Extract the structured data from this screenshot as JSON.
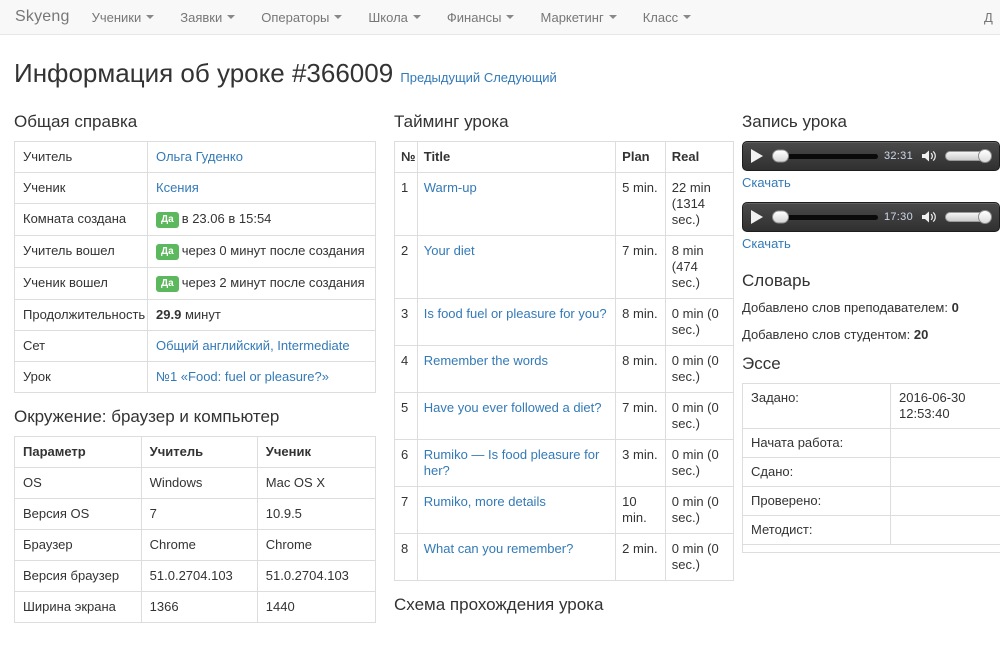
{
  "navbar": {
    "brand": "Skyeng",
    "items": [
      {
        "label": "Ученики",
        "caret": true
      },
      {
        "label": "Заявки",
        "caret": true
      },
      {
        "label": "Операторы",
        "caret": true
      },
      {
        "label": "Школа",
        "caret": true
      },
      {
        "label": "Финансы",
        "caret": true
      },
      {
        "label": "Маркетинг",
        "caret": true
      },
      {
        "label": "Класс",
        "caret": true
      }
    ],
    "right_user": "Д"
  },
  "page": {
    "title": "Информация об уроке #366009",
    "prev_link": "Предыдущий",
    "next_link": "Следующий"
  },
  "general": {
    "heading": "Общая справка",
    "rows": [
      {
        "label": "Учитель",
        "value": "Ольга Гуденко",
        "link": true
      },
      {
        "label": "Ученик",
        "value": "Ксения",
        "link": true
      },
      {
        "label": "Комната создана",
        "badge": "Да",
        "value": "в 23.06 в 15:54"
      },
      {
        "label": "Учитель вошел",
        "badge": "Да",
        "value": "через 0 минут после создания"
      },
      {
        "label": "Ученик вошел",
        "badge": "Да",
        "value": "через 2 минут после создания"
      },
      {
        "label": "Продолжительность",
        "value_bold": "29.9",
        "value": "минут"
      },
      {
        "label": "Сет",
        "value": "Общий английский, Intermediate",
        "link": true
      },
      {
        "label": "Урок",
        "value": "№1 «Food: fuel or pleasure?»",
        "link": true
      }
    ]
  },
  "environment": {
    "heading": "Окружение: браузер и компьютер",
    "columns": [
      "Параметр",
      "Учитель",
      "Ученик"
    ],
    "rows": [
      [
        "OS",
        "Windows",
        "Mac OS X"
      ],
      [
        "Версия OS",
        "7",
        "10.9.5"
      ],
      [
        "Браузер",
        "Chrome",
        "Chrome"
      ],
      [
        "Версия браузер",
        "51.0.2704.103",
        "51.0.2704.103"
      ],
      [
        "Ширина экрана",
        "1366",
        "1440"
      ]
    ]
  },
  "timing": {
    "heading": "Тайминг урока",
    "columns": [
      "№",
      "Title",
      "Plan",
      "Real"
    ],
    "rows": [
      {
        "num": "1",
        "title": "Warm-up",
        "plan": "5 min.",
        "real": "22 min (1314 sec.)"
      },
      {
        "num": "2",
        "title": "Your diet",
        "plan": "7 min.",
        "real": "8 min (474 sec.)"
      },
      {
        "num": "3",
        "title": "Is food fuel or pleasure for you?",
        "plan": "8 min.",
        "real": "0 min (0 sec.)"
      },
      {
        "num": "4",
        "title": "Remember the words",
        "plan": "8 min.",
        "real": "0 min (0 sec.)"
      },
      {
        "num": "5",
        "title": "Have you ever followed a diet?",
        "plan": "7 min.",
        "real": "0 min (0 sec.)"
      },
      {
        "num": "6",
        "title": "Rumiko — Is food pleasure for her?",
        "plan": "3 min.",
        "real": "0 min (0 sec.)"
      },
      {
        "num": "7",
        "title": "Rumiko, more details",
        "plan": "10 min.",
        "real": "0 min (0 sec.)"
      },
      {
        "num": "8",
        "title": "What can you remember?",
        "plan": "2 min.",
        "real": "0 min (0 sec.)"
      }
    ],
    "scheme_heading": "Схема прохождения урока"
  },
  "recording": {
    "heading": "Запись урока",
    "players": [
      {
        "time": "32:31",
        "download_label": "Скачать"
      },
      {
        "time": "17:30",
        "download_label": "Скачать"
      }
    ]
  },
  "dictionary": {
    "heading": "Словарь",
    "teacher_label": "Добавлено слов преподавателем:",
    "teacher_count": "0",
    "student_label": "Добавлено слов студентом:",
    "student_count": "20"
  },
  "essay": {
    "heading": "Эссе",
    "rows": [
      {
        "label": "Задано:",
        "value": "2016-06-30 12:53:40"
      },
      {
        "label": "Начата работа:",
        "value": ""
      },
      {
        "label": "Сдано:",
        "value": ""
      },
      {
        "label": "Проверено:",
        "value": ""
      },
      {
        "label": "Методист:",
        "value": ""
      }
    ]
  },
  "colors": {
    "link": "#337ab7",
    "badge_green": "#5cb85c",
    "navbar_bg": "#f8f8f8",
    "border": "#dddddd"
  }
}
